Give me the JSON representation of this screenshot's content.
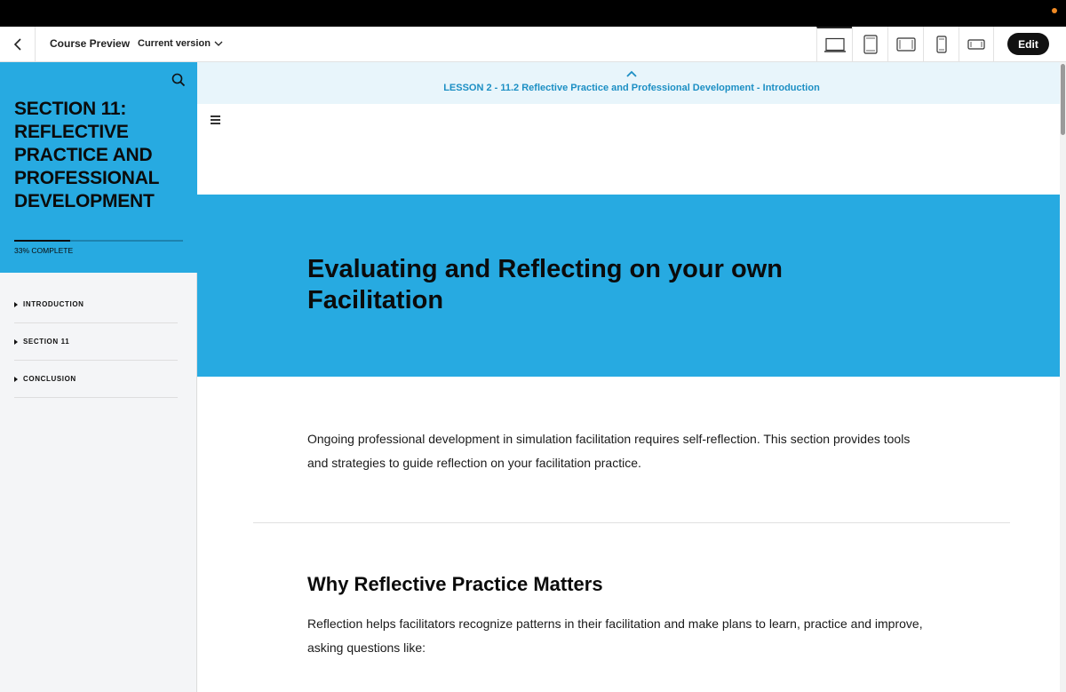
{
  "topbar": {
    "course_preview": "Course Preview",
    "version_label": "Current version",
    "edit_label": "Edit"
  },
  "sidebar": {
    "section_title": "SECTION 11: REFLECTIVE PRACTICE AND PROFESSIONAL DEVELOPMENT",
    "progress_percent": 33,
    "progress_label": "33% COMPLETE",
    "items": [
      {
        "label": "INTRODUCTION"
      },
      {
        "label": "SECTION 11"
      },
      {
        "label": "CONCLUSION"
      }
    ]
  },
  "main": {
    "lesson_label": "LESSON 2 - 11.2 Reflective Practice and Professional Development - Introduction",
    "hero_title": "Evaluating and Reflecting on your own Facilitation",
    "intro_text": "Ongoing professional development in simulation facilitation requires self-reflection. This section provides tools and strategies to guide reflection on your facilitation practice.",
    "heading_1": "Why Reflective Practice Matters",
    "body_1": "Reflection helps facilitators recognize patterns in their facilitation and make plans to learn, practice and improve, asking questions like:"
  },
  "colors": {
    "accent": "#27aae1",
    "lesson_text": "#1c8fc4",
    "dark": "#0b0b0b"
  }
}
